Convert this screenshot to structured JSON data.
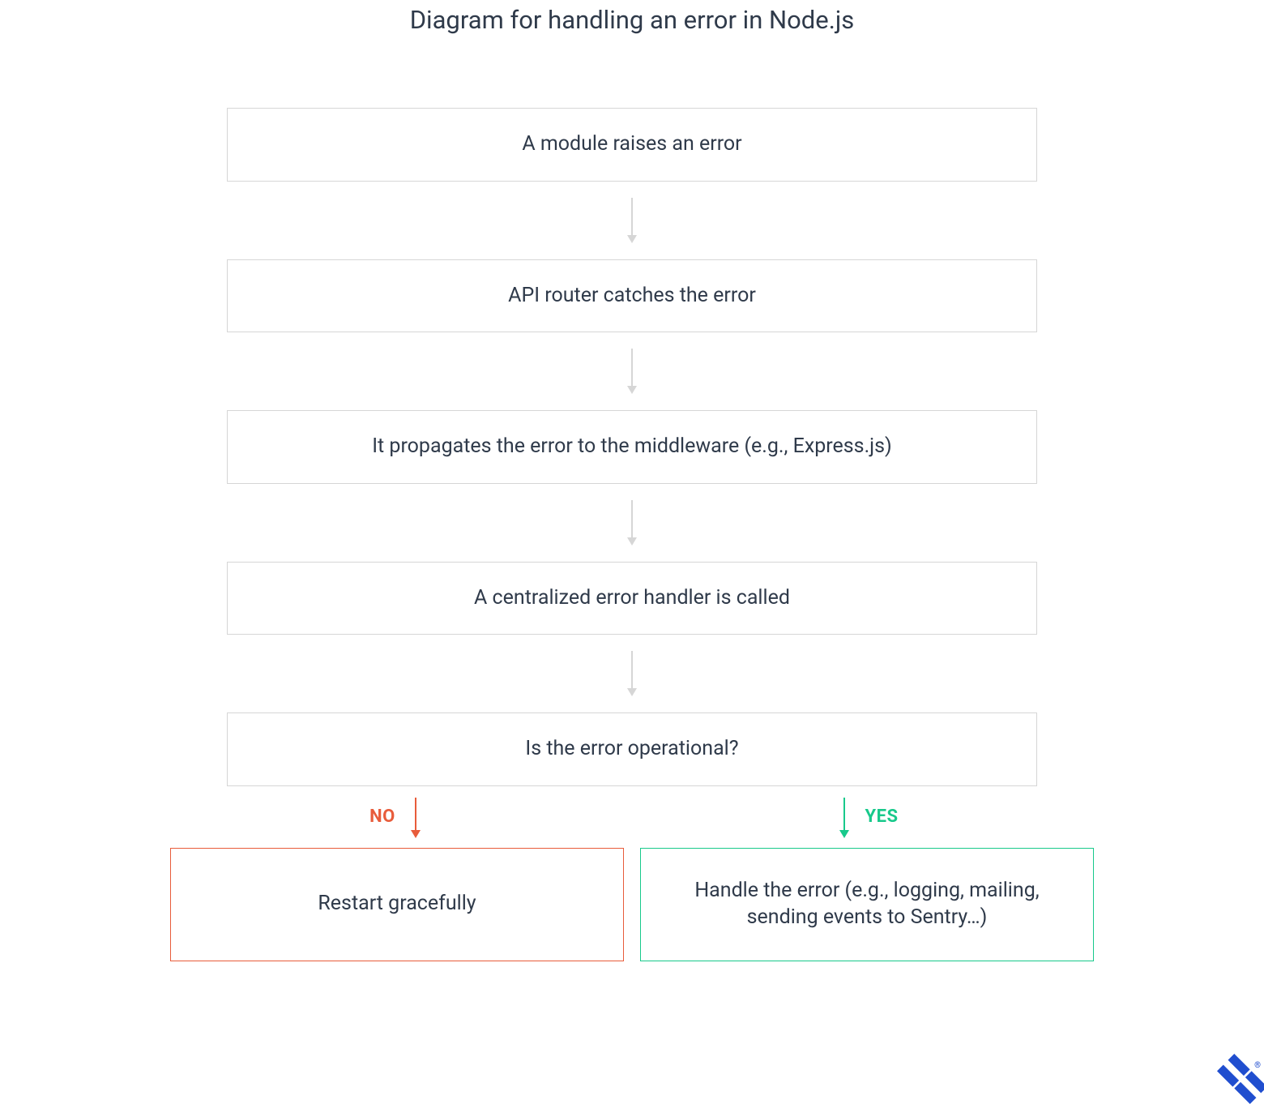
{
  "title": "Diagram for handling an error in Node.js",
  "steps": {
    "s1": "A module raises an error",
    "s2": "API router catches the error",
    "s3": "It propagates the error to the middleware (e.g., Express.js)",
    "s4": "A centralized error handler is called",
    "s5": "Is the error operational?"
  },
  "branches": {
    "no_label": "NO",
    "yes_label": "YES",
    "no_box": "Restart gracefully",
    "yes_box": "Handle the error (e.g., logging, mailing, sending events to Sentry…)"
  },
  "colors": {
    "text": "#2f3a4a",
    "border": "#d6d6d6",
    "no": "#e85c3b",
    "yes": "#18c98b",
    "arrow": "#d6d6d6",
    "brand": "#204ecf"
  },
  "logo": {
    "name": "toptal-logo",
    "registered": "®"
  }
}
